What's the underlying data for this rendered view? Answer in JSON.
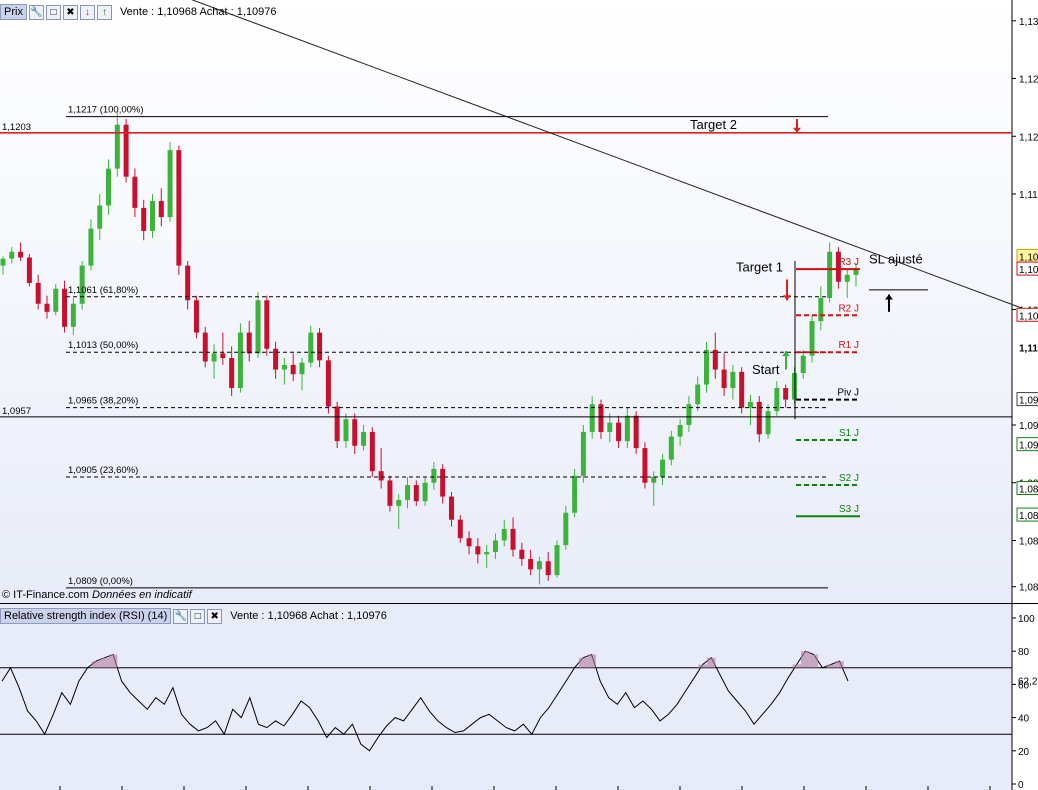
{
  "header": {
    "title": "Prix",
    "quote": "Vente : 1,10968 Achat : 1,10976",
    "icons": [
      "wrench-icon",
      "window-icon",
      "close-icon",
      "download-icon",
      "upload-icon"
    ]
  },
  "rsi_header": {
    "title": "Relative strength index (RSI) (14)",
    "quote": "Vente : 1,10968 Achat : 1,10976",
    "icons": [
      "wrench-icon",
      "window-icon",
      "close-icon"
    ]
  },
  "footer": {
    "source": "© IT-Finance.com",
    "note": "Données en indicatif"
  },
  "colors": {
    "background_top": "#ffffff",
    "background_bottom": "#e8ecf8",
    "up_candle": "#3cb43c",
    "down_candle": "#c8102e",
    "target_line": "#e02020",
    "resistance": "#d01010",
    "support": "#108010"
  },
  "chart_data": [
    {
      "type": "candlestick",
      "title": "",
      "ylim": [
        1.0795,
        1.1318
      ],
      "yticks": [
        {
          "label": "1,13",
          "value": 1.13
        },
        {
          "label": "1,12",
          "value": 1.125
        },
        {
          "label": "1,12",
          "value": 1.12
        },
        {
          "label": "1,11",
          "value": 1.115
        },
        {
          "label": "1,10",
          "value": 1.105
        },
        {
          "label": "1,09",
          "value": 1.095
        },
        {
          "label": "1,08",
          "value": 1.09
        },
        {
          "label": "1,08",
          "value": 1.085
        },
        {
          "label": "1,08",
          "value": 1.081
        }
      ],
      "price_tags": [
        {
          "label": "1,10",
          "value": 1.1096,
          "color": "#fff3a0",
          "border": "#c8a000"
        },
        {
          "label": "1,10",
          "value": 1.1085,
          "color": "#ffffff",
          "border": "#d01010"
        },
        {
          "label": "1,10",
          "value": 1.1045,
          "color": "#ffffff",
          "border": "#d01010"
        },
        {
          "label": "1,11",
          "value": 1.1017,
          "color": null,
          "border": null
        },
        {
          "label": "1,09",
          "value": 1.0972,
          "color": "#ffffff",
          "border": "#404040"
        },
        {
          "label": "1,09",
          "value": 1.0933,
          "color": "#ffffff",
          "border": "#108010"
        },
        {
          "label": "1,08",
          "value": 1.0895,
          "color": "#ffffff",
          "border": "#108010"
        },
        {
          "label": "1,08",
          "value": 1.0872,
          "color": "#ffffff",
          "border": "#108010"
        }
      ],
      "fibonacci": [
        {
          "label": "1,1217 (100,00%)",
          "value": 1.1217,
          "style": "solid"
        },
        {
          "label": "1,1061 (61,80%)",
          "value": 1.1061,
          "style": "dashed"
        },
        {
          "label": "1,1013 (50,00%)",
          "value": 1.1013,
          "style": "dashed"
        },
        {
          "label": "1,0965 (38,20%)",
          "value": 1.0965,
          "style": "dashed"
        },
        {
          "label": "1,0905 (23,60%)",
          "value": 1.0905,
          "style": "dashed"
        },
        {
          "label": "1,0809 (0,00%)",
          "value": 1.0809,
          "style": "solid"
        }
      ],
      "horizontal_lines": [
        {
          "label": "1,1203",
          "value": 1.1203,
          "color": "#e02020"
        },
        {
          "label": "1,0957",
          "value": 1.0957,
          "color": "#000000"
        }
      ],
      "pivots": [
        {
          "label": "R3 J",
          "value": 1.1085,
          "color": "#d01010",
          "style": "solid"
        },
        {
          "label": "R2 J",
          "value": 1.1045,
          "color": "#d01010",
          "style": "dashed"
        },
        {
          "label": "R1 J",
          "value": 1.1013,
          "color": "#d01010",
          "style": "dashed"
        },
        {
          "label": "Piv J",
          "value": 1.0972,
          "color": "#000000",
          "style": "dashed"
        },
        {
          "label": "S1 J",
          "value": 1.0937,
          "color": "#108010",
          "style": "dashed"
        },
        {
          "label": "S2 J",
          "value": 1.0898,
          "color": "#108010",
          "style": "dashed"
        },
        {
          "label": "S3 J",
          "value": 1.0871,
          "color": "#108010",
          "style": "solid"
        }
      ],
      "trendline": {
        "from": {
          "bar": 0,
          "value": 1.138
        },
        "to": {
          "bar": 1038,
          "value": 1.1046
        }
      },
      "annotations": [
        {
          "text": "Target 2",
          "arrow": "down"
        },
        {
          "text": "Target 1",
          "arrow": "down"
        },
        {
          "text": "Start",
          "arrow": "up"
        },
        {
          "text": "SL ajusté",
          "arrow": "up"
        }
      ],
      "candles": [
        [
          1.1088,
          1.1096,
          1.108,
          1.1094
        ],
        [
          1.1094,
          1.1104,
          1.109,
          1.11
        ],
        [
          1.11,
          1.1108,
          1.1092,
          1.1095
        ],
        [
          1.1095,
          1.1098,
          1.107,
          1.1073
        ],
        [
          1.1073,
          1.108,
          1.105,
          1.1055
        ],
        [
          1.1055,
          1.1062,
          1.1042,
          1.1048
        ],
        [
          1.1048,
          1.1072,
          1.1045,
          1.1068
        ],
        [
          1.1068,
          1.1075,
          1.103,
          1.1035
        ],
        [
          1.1035,
          1.106,
          1.1028,
          1.1055
        ],
        [
          1.1055,
          1.1092,
          1.105,
          1.1088
        ],
        [
          1.1088,
          1.1128,
          1.1084,
          1.112
        ],
        [
          1.112,
          1.115,
          1.111,
          1.114
        ],
        [
          1.114,
          1.118,
          1.1132,
          1.1172
        ],
        [
          1.1172,
          1.1222,
          1.1165,
          1.121
        ],
        [
          1.121,
          1.1215,
          1.116,
          1.1165
        ],
        [
          1.1165,
          1.1172,
          1.113,
          1.1138
        ],
        [
          1.1138,
          1.1145,
          1.111,
          1.1118
        ],
        [
          1.1118,
          1.115,
          1.1112,
          1.1144
        ],
        [
          1.1144,
          1.1155,
          1.1122,
          1.113
        ],
        [
          1.113,
          1.1195,
          1.1126,
          1.1188
        ],
        [
          1.1188,
          1.1192,
          1.108,
          1.1088
        ],
        [
          1.1088,
          1.1092,
          1.105,
          1.1058
        ],
        [
          1.1058,
          1.1062,
          1.1025,
          1.103
        ],
        [
          1.103,
          1.1035,
          1.1,
          1.1005
        ],
        [
          1.1005,
          1.102,
          1.099,
          1.1012
        ],
        [
          1.1012,
          1.103,
          1.1002,
          1.1008
        ],
        [
          1.1008,
          1.1018,
          1.0975,
          1.0982
        ],
        [
          1.0982,
          1.1038,
          1.0978,
          1.103
        ],
        [
          1.103,
          1.104,
          1.1005,
          1.1012
        ],
        [
          1.1012,
          1.1065,
          1.1008,
          1.1058
        ],
        [
          1.1058,
          1.1062,
          1.101,
          1.1016
        ],
        [
          1.1016,
          1.1022,
          1.099,
          1.0998
        ],
        [
          1.0998,
          1.1008,
          1.0985,
          1.1002
        ],
        [
          1.1002,
          1.1012,
          1.0988,
          1.0994
        ],
        [
          1.0994,
          1.1008,
          1.098,
          1.1004
        ],
        [
          1.1004,
          1.1036,
          1.1,
          1.103
        ],
        [
          1.103,
          1.1034,
          1.1,
          1.1006
        ],
        [
          1.1006,
          1.101,
          1.096,
          1.0966
        ],
        [
          1.0966,
          1.097,
          1.093,
          1.0936
        ],
        [
          1.0936,
          1.096,
          1.093,
          1.0955
        ],
        [
          1.0955,
          1.096,
          1.0925,
          1.0932
        ],
        [
          1.0932,
          1.095,
          1.0928,
          1.0944
        ],
        [
          1.0944,
          1.0948,
          1.0905,
          1.091
        ],
        [
          1.091,
          1.093,
          1.0895,
          1.0902
        ],
        [
          1.0902,
          1.0906,
          1.0875,
          1.088
        ],
        [
          1.088,
          1.089,
          1.086,
          1.0885
        ],
        [
          1.0885,
          1.0905,
          1.0878,
          1.0898
        ],
        [
          1.0898,
          1.0902,
          1.088,
          1.0884
        ],
        [
          1.0884,
          1.0905,
          1.088,
          1.09
        ],
        [
          1.09,
          1.0918,
          1.0894,
          1.0912
        ],
        [
          1.0912,
          1.0916,
          1.0882,
          1.0888
        ],
        [
          1.0888,
          1.0892,
          1.0862,
          1.0868
        ],
        [
          1.0868,
          1.0872,
          1.0848,
          1.0852
        ],
        [
          1.0852,
          1.0858,
          1.0838,
          1.0845
        ],
        [
          1.0845,
          1.0852,
          1.083,
          1.0838
        ],
        [
          1.0838,
          1.0846,
          1.0826,
          1.084
        ],
        [
          1.084,
          1.0856,
          1.0834,
          1.085
        ],
        [
          1.085,
          1.0868,
          1.0845,
          1.086
        ],
        [
          1.086,
          1.087,
          1.0836,
          1.0842
        ],
        [
          1.0842,
          1.0848,
          1.0828,
          1.0834
        ],
        [
          1.0834,
          1.0842,
          1.082,
          1.0825
        ],
        [
          1.0825,
          1.0836,
          1.0812,
          1.0832
        ],
        [
          1.0832,
          1.084,
          1.0815,
          1.082
        ],
        [
          1.082,
          1.085,
          1.0818,
          1.0846
        ],
        [
          1.0846,
          1.088,
          1.0842,
          1.0874
        ],
        [
          1.0874,
          1.0912,
          1.087,
          1.0906
        ],
        [
          1.0906,
          1.095,
          1.09,
          1.0944
        ],
        [
          1.0944,
          1.0975,
          1.0938,
          1.0968
        ],
        [
          1.0968,
          1.0972,
          1.0938,
          1.0944
        ],
        [
          1.0944,
          1.096,
          1.0935,
          1.0952
        ],
        [
          1.0952,
          1.0958,
          1.093,
          1.0936
        ],
        [
          1.0936,
          1.0965,
          1.093,
          1.0958
        ],
        [
          1.0958,
          1.0962,
          1.0925,
          1.093
        ],
        [
          1.093,
          1.0935,
          1.0895,
          1.09
        ],
        [
          1.09,
          1.091,
          1.088,
          1.0905
        ],
        [
          1.0905,
          1.0925,
          1.0898,
          1.092
        ],
        [
          1.092,
          1.0945,
          1.0915,
          1.094
        ],
        [
          1.094,
          1.0955,
          1.0932,
          1.095
        ],
        [
          1.095,
          1.0975,
          1.0944,
          1.0968
        ],
        [
          1.0968,
          1.0992,
          1.0962,
          1.0985
        ],
        [
          1.0985,
          1.1022,
          1.0978,
          1.1015
        ],
        [
          1.1015,
          1.103,
          1.099,
          1.0998
        ],
        [
          1.0998,
          1.1012,
          1.0975,
          1.0982
        ],
        [
          1.0982,
          1.1002,
          1.0972,
          1.0996
        ],
        [
          1.0996,
          1.1,
          1.096,
          1.0965
        ],
        [
          1.0965,
          1.0976,
          1.095,
          1.097
        ],
        [
          1.097,
          1.0975,
          1.0935,
          1.0942
        ],
        [
          1.0942,
          1.0968,
          1.0938,
          1.0962
        ],
        [
          1.0962,
          1.0988,
          1.0958,
          1.0982
        ],
        [
          1.0982,
          1.0985,
          1.0965,
          1.0972
        ],
        [
          1.0972,
          1.1,
          1.0968,
          1.0995
        ],
        [
          1.0995,
          1.1015,
          1.099,
          1.101
        ],
        [
          1.101,
          1.1045,
          1.1004,
          1.104
        ],
        [
          1.104,
          1.107,
          1.1032,
          1.106
        ],
        [
          1.106,
          1.1108,
          1.1056,
          1.11
        ],
        [
          1.11,
          1.1104,
          1.1068,
          1.1074
        ],
        [
          1.1074,
          1.1085,
          1.106,
          1.108
        ],
        [
          1.108,
          1.109,
          1.107,
          1.1086
        ]
      ]
    },
    {
      "type": "line",
      "title": "Relative strength index (RSI) (14)",
      "ylim": [
        0,
        100
      ],
      "yticks": [
        0,
        20,
        40,
        60,
        80,
        100
      ],
      "levels": [
        70,
        30
      ],
      "last_value_label": "62,2",
      "values": [
        62,
        70,
        58,
        44,
        38,
        30,
        42,
        55,
        48,
        62,
        70,
        74,
        76,
        78,
        62,
        55,
        50,
        45,
        52,
        48,
        58,
        42,
        36,
        32,
        34,
        38,
        30,
        45,
        40,
        52,
        36,
        34,
        38,
        35,
        42,
        50,
        46,
        38,
        28,
        34,
        30,
        36,
        24,
        20,
        28,
        35,
        40,
        38,
        45,
        52,
        44,
        38,
        34,
        31,
        32,
        36,
        40,
        42,
        38,
        34,
        32,
        36,
        30,
        40,
        46,
        54,
        62,
        70,
        76,
        78,
        62,
        52,
        48,
        55,
        46,
        50,
        45,
        38,
        42,
        48,
        56,
        64,
        72,
        76,
        66,
        56,
        50,
        44,
        36,
        42,
        48,
        55,
        64,
        72,
        80,
        78,
        70,
        72,
        74,
        62
      ]
    }
  ]
}
